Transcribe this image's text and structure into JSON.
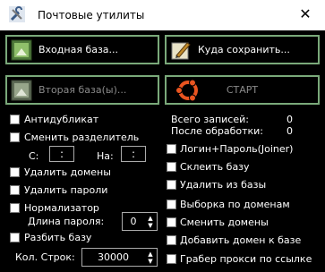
{
  "window": {
    "title": "Почтовые утилиты",
    "close_glyph": "✕",
    "icon": "tools-icon"
  },
  "buttons": {
    "input_db": "Входная база...",
    "save_to": "Куда сохранить...",
    "second_db": "Вторая база(ы)...",
    "start": "СТАРТ"
  },
  "left": {
    "antidup": "Антидубликат",
    "change_sep": "Сменить разделитель",
    "from_label": "С:",
    "from_value": ":",
    "to_label": "На:",
    "to_value": ":",
    "remove_domains": "Удалить домены",
    "remove_passwords": "Удалить пароли",
    "normalizer": "Нормализатор",
    "pwd_len_label": "Длина пароля:",
    "pwd_len_value": "0",
    "split_db": "Разбить базу",
    "lines_label": "Кол. Строк:",
    "lines_value": "30000"
  },
  "stats": {
    "total_label": "Всего записей:",
    "total_value": "0",
    "after_label": "После обработки:",
    "after_value": "0"
  },
  "right": {
    "login_pass": "Логин+Пароль(Joiner)",
    "glue_db": "Склеить базу",
    "remove_from_db": "Удалить из базы",
    "select_domains": "Выборка по доменам",
    "change_domains": "Сменить домены",
    "add_domain": "Добавить домен к базе",
    "proxy_grabber": "Грабер прокси по ссылке"
  }
}
